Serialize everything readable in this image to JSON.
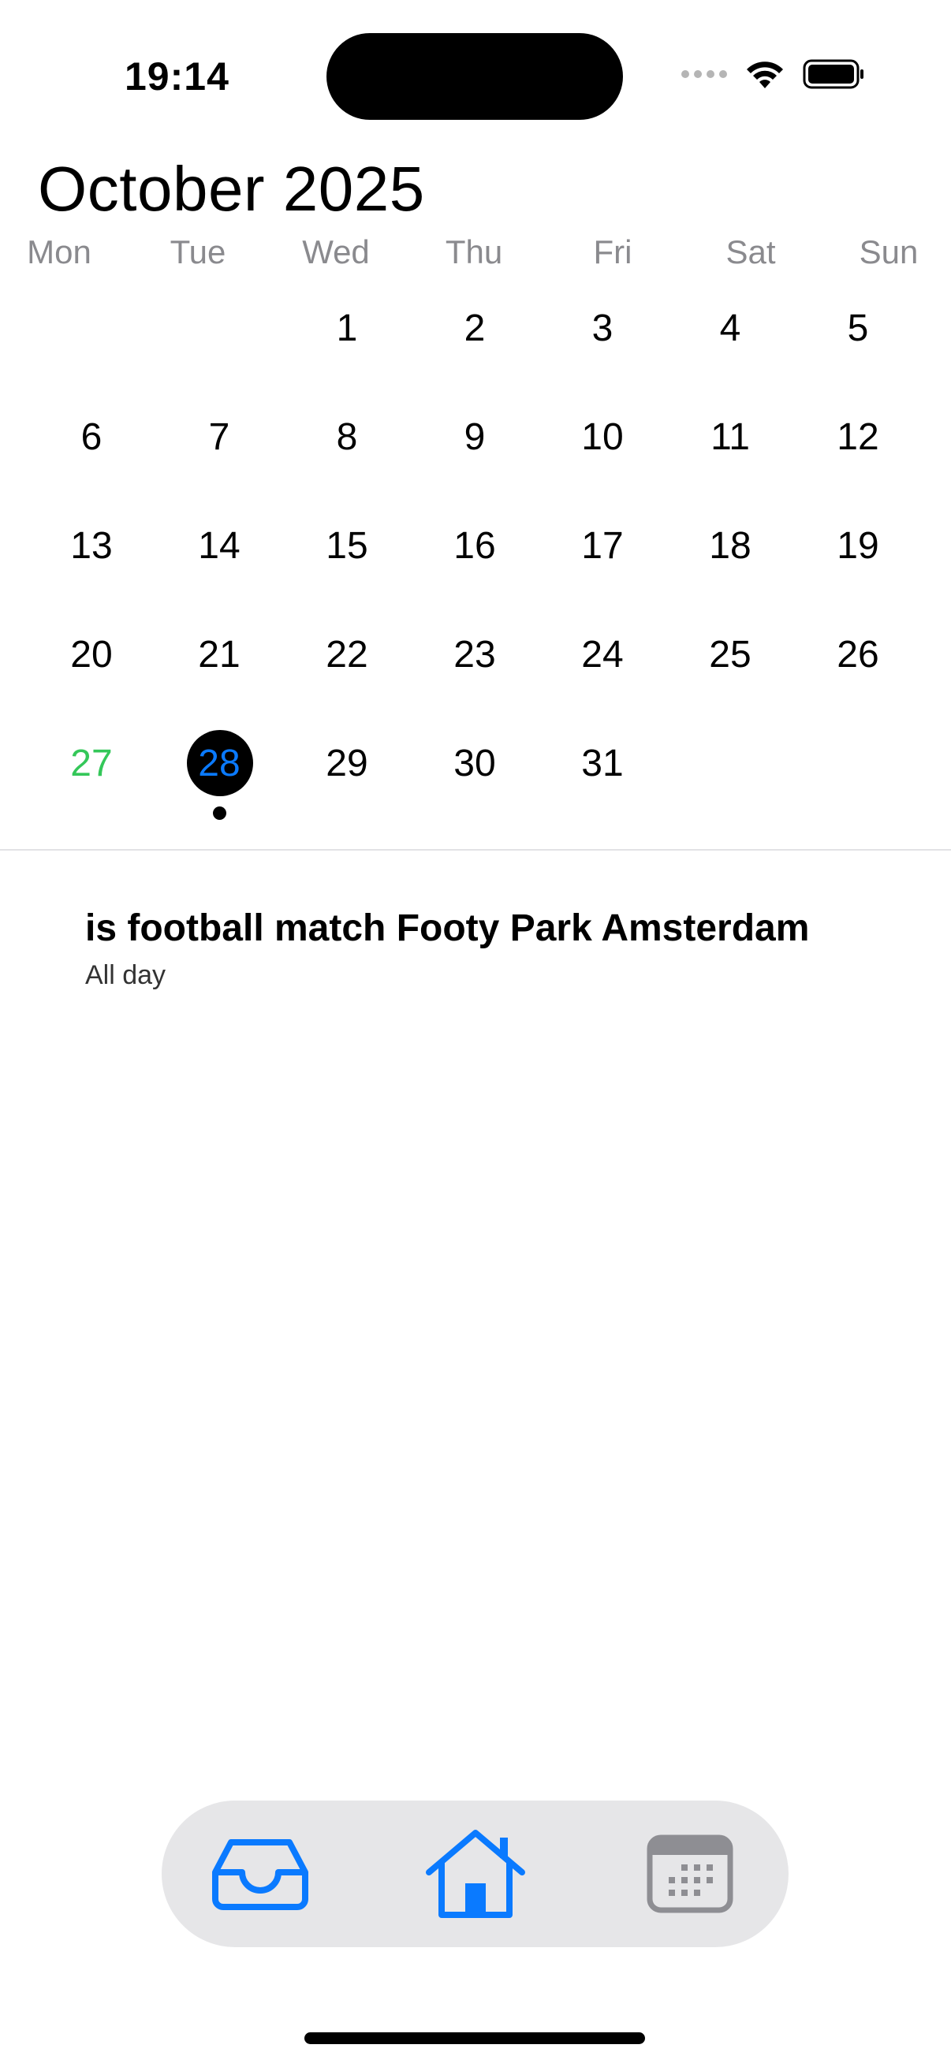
{
  "status_bar": {
    "time": "19:14"
  },
  "calendar": {
    "month_title": "October 2025",
    "weekdays": [
      "Mon",
      "Tue",
      "Wed",
      "Thu",
      "Fri",
      "Sat",
      "Sun"
    ],
    "weeks": [
      [
        "",
        "",
        "1",
        "2",
        "3",
        "4",
        "5"
      ],
      [
        "6",
        "7",
        "8",
        "9",
        "10",
        "11",
        "12"
      ],
      [
        "13",
        "14",
        "15",
        "16",
        "17",
        "18",
        "19"
      ],
      [
        "20",
        "21",
        "22",
        "23",
        "24",
        "25",
        "26"
      ],
      [
        "27",
        "28",
        "29",
        "30",
        "31",
        "",
        ""
      ]
    ],
    "today": "27",
    "selected": "28",
    "today_color": "#34c759",
    "selected_color": "#0a7aff"
  },
  "event": {
    "title": "is football match Footy Park Amsterdam",
    "time": "All day"
  },
  "tab_bar": {
    "items": [
      {
        "icon": "inbox-icon"
      },
      {
        "icon": "home-icon"
      },
      {
        "icon": "calendar-icon"
      }
    ],
    "accent_color": "#0a7aff",
    "inactive_color": "#8e8e93"
  }
}
